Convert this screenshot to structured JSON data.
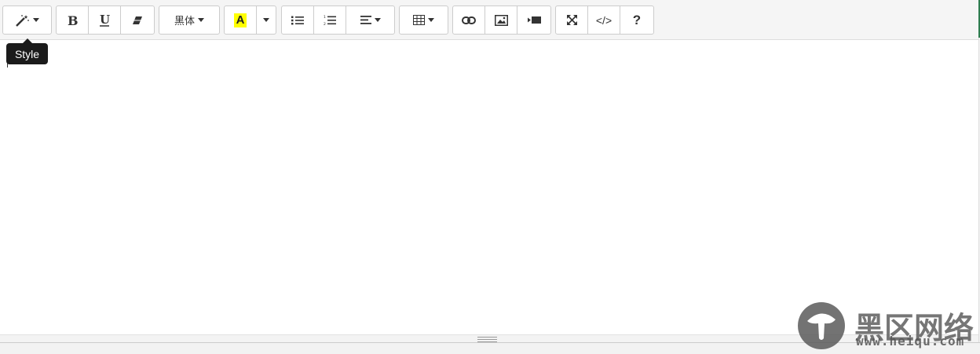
{
  "toolbar": {
    "style": {
      "tooltip": "Style"
    },
    "font": {
      "name": "黑体"
    },
    "color": {
      "letter": "A",
      "highlight": "#ffff00"
    },
    "help": {
      "label": "?"
    },
    "codeview": {
      "label": "</>"
    }
  },
  "icons": [
    "magic-wand-icon",
    "bold-icon",
    "underline-icon",
    "eraser-icon",
    "font-color-icon",
    "unordered-list-icon",
    "ordered-list-icon",
    "align-left-icon",
    "table-icon",
    "link-icon",
    "picture-icon",
    "video-icon",
    "fullscreen-icon",
    "code-icon",
    "help-icon"
  ],
  "watermark": {
    "chinese": "黑区网络",
    "url": "www.heiqu.com"
  },
  "colors": {
    "tooltip_bg": "#1b1b1b",
    "accent": "#2e7d4f"
  }
}
